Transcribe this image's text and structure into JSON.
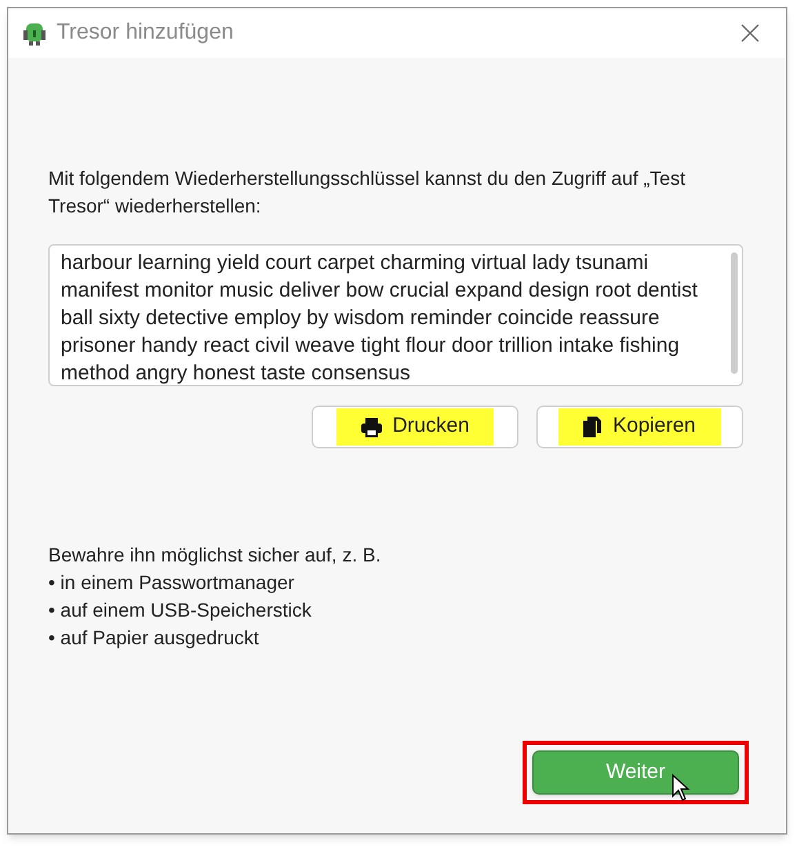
{
  "window": {
    "title": "Tresor hinzufügen"
  },
  "intro": "Mit folgendem Wiederherstellungsschlüssel kannst du den Zugriff auf „Test Tresor“ wiederherstellen:",
  "recovery_key": "harbour learning yield court carpet charming virtual lady tsunami manifest monitor music deliver bow crucial expand design root dentist ball sixty detective employ by wisdom reminder coincide reassure prisoner handy react civil weave tight flour door trillion intake fishing method angry honest taste consensus",
  "actions": [
    {
      "kind": "print",
      "label": "Drucken",
      "highlighted": true
    },
    {
      "kind": "copy",
      "label": "Kopieren",
      "highlighted": true
    }
  ],
  "advice": "Bewahre ihn möglichst sicher auf, z. B.",
  "advice_items": [
    "• in einem Passwortmanager",
    "• auf einem USB-Speicherstick",
    "• auf Papier ausgedruckt"
  ],
  "next_button": {
    "label": "Weiter",
    "highlighted": true
  }
}
